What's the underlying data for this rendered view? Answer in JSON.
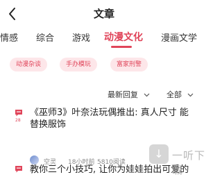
{
  "header": {
    "title": "文章"
  },
  "tabs": [
    {
      "label": "情感"
    },
    {
      "label": "综合"
    },
    {
      "label": "游戏"
    },
    {
      "label": "动漫文化"
    },
    {
      "label": "漫画文学"
    }
  ],
  "chips": [
    {
      "label": "动漫杂谈"
    },
    {
      "label": "手办模玩"
    },
    {
      "label": "富家刑警"
    }
  ],
  "filters": {
    "sort_label": "最新回复",
    "scope_label": "全部"
  },
  "posts": [
    {
      "index": "28",
      "title_line1": "《巫师3》叶奈法玩偶推出: 真人尺寸 能",
      "title_line2": "替换服饰",
      "author": "空灵",
      "time": "18小时前",
      "views": "5810阅读"
    },
    {
      "title_line1": "教你三个小技巧, 让你为娃娃拍出可爱的"
    }
  ],
  "watermark": {
    "text": "一听下载"
  },
  "colors": {
    "accent": "#e0455a",
    "chip_bg": "#fde6e9"
  }
}
